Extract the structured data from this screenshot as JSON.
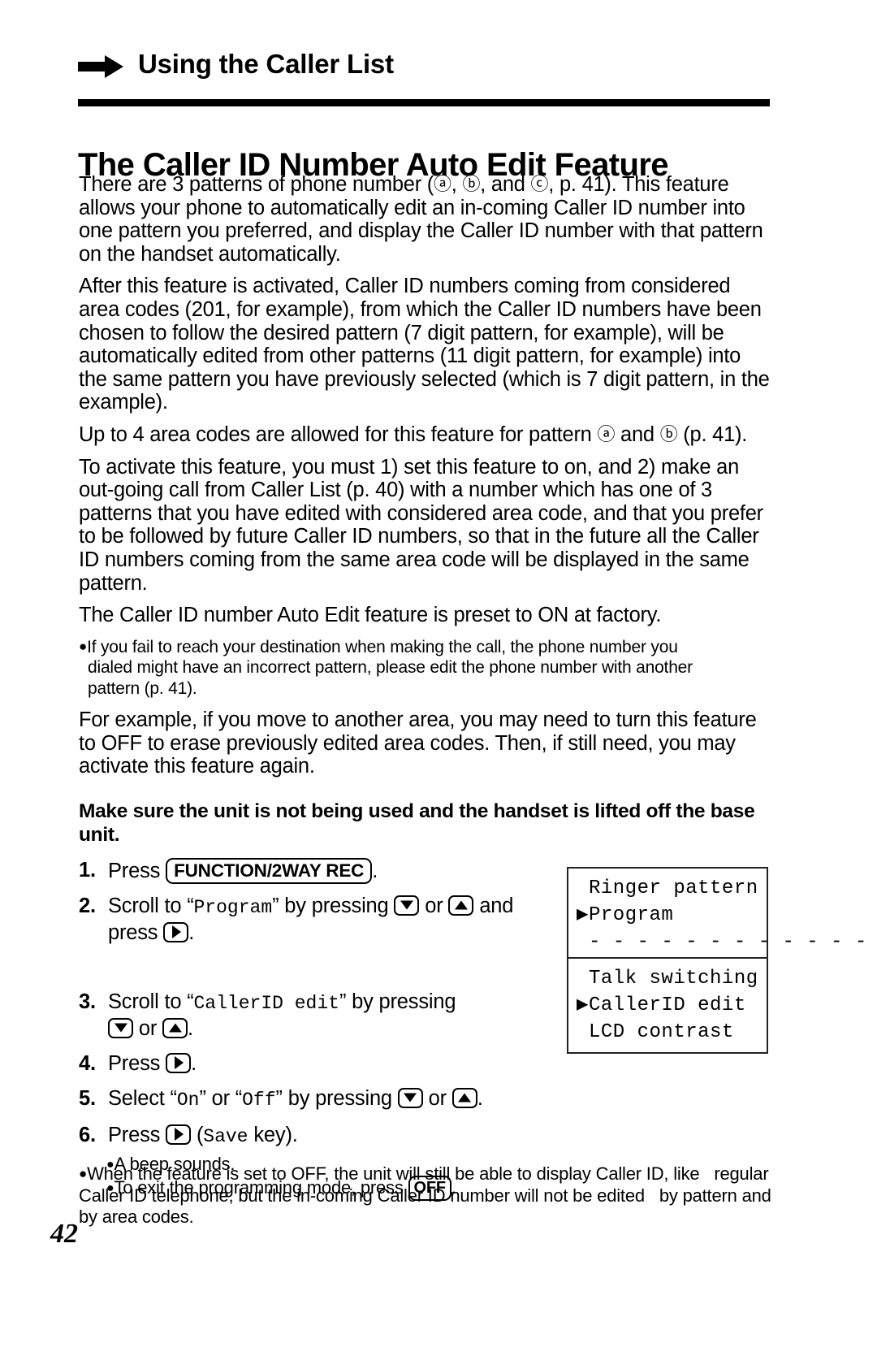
{
  "header": {
    "arrow_icon": "right-arrow-icon",
    "running_title": "Using the Caller List"
  },
  "title": "The Caller ID Number Auto Edit Feature",
  "paragraphs": {
    "p1_a": "There are 3 patterns of phone number (",
    "p1_ca": "ⓐ",
    "p1_b": ", ",
    "p1_cb": "ⓑ",
    "p1_c": ", and ",
    "p1_cc": "ⓒ",
    "p1_d": ", p. 41). This feature allows your phone to automatically edit an in-coming Caller ID number into one pattern you preferred, and display the Caller ID number with that pattern on the handset automatically.",
    "p2": "After this feature is activated, Caller ID numbers coming from considered area codes (201, for example), from which the Caller ID numbers have been chosen to follow the desired pattern (7 digit pattern, for example), will be automatically edited from other patterns (11 digit pattern, for example) into the same pattern you have previously selected (which is 7 digit pattern, in the example).",
    "p3_a": "Up to 4 area codes are allowed for this feature for pattern ",
    "p3_ca": "ⓐ",
    "p3_b": " and ",
    "p3_cb": "ⓑ",
    "p3_c": " (p. 41).",
    "p4": "To activate this feature, you must 1) set this feature to on, and 2) make an out-going call from Caller List (p. 40) with a number which has one of 3 patterns that you have edited with considered area code, and that you prefer to be followed by future Caller ID numbers, so that in the future all the Caller ID numbers coming from the same area code will be displayed in the same pattern.",
    "p5": "The Caller ID number Auto Edit feature is preset to ON at factory.",
    "note1_line1": "If you fail to reach your destination when making the call, the phone number you",
    "note1_line2": "dialed might have an incorrect pattern, please edit the phone number with another",
    "note1_line3": "pattern (p. 41).",
    "p6": "For example, if you move to another area, you may need to turn this feature to OFF to erase previously edited area codes. Then, if still need, you may activate this feature again.",
    "bold_note": "Make sure the unit is not being used and the handset is lifted off the base unit."
  },
  "steps": [
    {
      "num": "1.",
      "pre": "Press ",
      "key": "FUNCTION/2WAY REC",
      "post": "."
    },
    {
      "num": "2.",
      "pre": "Scroll to “",
      "mono": "Program",
      "mid": "” by pressing ",
      "key_down": "down-arrow-key",
      "mid2": " or ",
      "key_up": "up-arrow-key",
      "mid3": " and",
      "line2_pre": "press ",
      "key_right": "right-arrow-key",
      "post": "."
    },
    {
      "num": "3.",
      "pre": "Scroll to “",
      "mono": "CallerID edit",
      "mid": "” by pressing",
      "line2_down": "down-arrow-key",
      "line2_mid": " or ",
      "line2_up": "up-arrow-key",
      "post": "."
    },
    {
      "num": "4.",
      "pre": "Press ",
      "key_right": "right-arrow-key",
      "post": "."
    },
    {
      "num": "5.",
      "pre": "Select “",
      "mono1": "On",
      "mid1": "” or “",
      "mono2": "Off",
      "mid2": "” by pressing ",
      "key_down": "down-arrow-key",
      "mid3": " or ",
      "key_up": "up-arrow-key",
      "post": "."
    },
    {
      "num": "6.",
      "pre": "Press ",
      "key_right": "right-arrow-key",
      "mid": " (",
      "mono": "Save",
      "post": " key)."
    }
  ],
  "substeps": {
    "sub1": "A beep sounds.",
    "sub2_pre": "To exit the programming mode, press ",
    "sub2_key": "OFF",
    "sub2_post": "."
  },
  "lcd_displays": [
    {
      "name": "lcd-program-menu",
      "lines": [
        {
          "caret": " ",
          "text": "Ringer pattern"
        },
        {
          "caret": "▶",
          "text": "Program"
        },
        {
          "caret": " ",
          "text": "- - - - - - - - - - - - -"
        }
      ]
    },
    {
      "name": "lcd-callerid-edit-menu",
      "lines": [
        {
          "caret": " ",
          "text": "Talk switching"
        },
        {
          "caret": "▶",
          "text": "CallerID edit"
        },
        {
          "caret": " ",
          "text": "LCD contrast"
        }
      ]
    }
  ],
  "final_note": {
    "line1": "When the feature is set to OFF, the unit will still be able to display Caller ID, like",
    "line2": "regular Caller ID telephone, but the in-coming Caller ID number will not be edited",
    "line3": "by pattern and by area codes."
  },
  "page_number": "42",
  "colors": {
    "ink": "#000000",
    "paper": "#ffffff"
  }
}
